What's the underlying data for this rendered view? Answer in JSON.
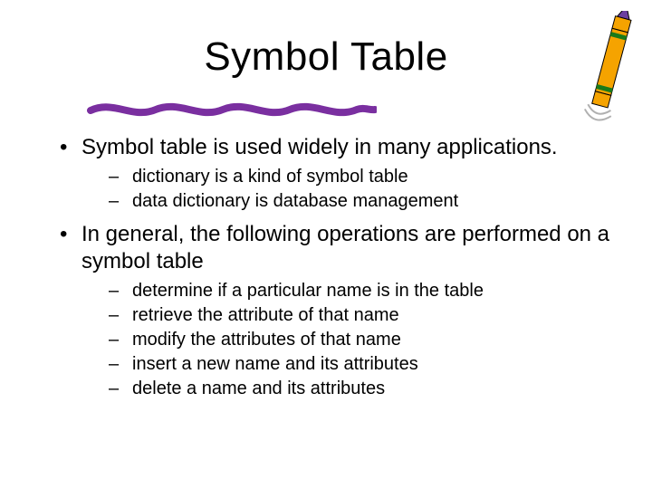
{
  "title": "Symbol Table",
  "bullets": [
    {
      "text": "Symbol table is used widely in many applications.",
      "sub": [
        "dictionary is a kind of symbol table",
        "data dictionary is database management"
      ]
    },
    {
      "text": "In general, the following operations are performed on a symbol table",
      "sub": [
        "determine if a particular name is in the table",
        "retrieve the attribute of that name",
        "modify the attributes of that name",
        "insert a new name and its attributes",
        "delete a name and its attributes"
      ]
    }
  ],
  "decor": {
    "underline_color": "#7a2fa0",
    "crayon_body": "#f5a300",
    "crayon_stripe": "#1a7a1a",
    "crayon_tip": "#6b3fa0"
  }
}
